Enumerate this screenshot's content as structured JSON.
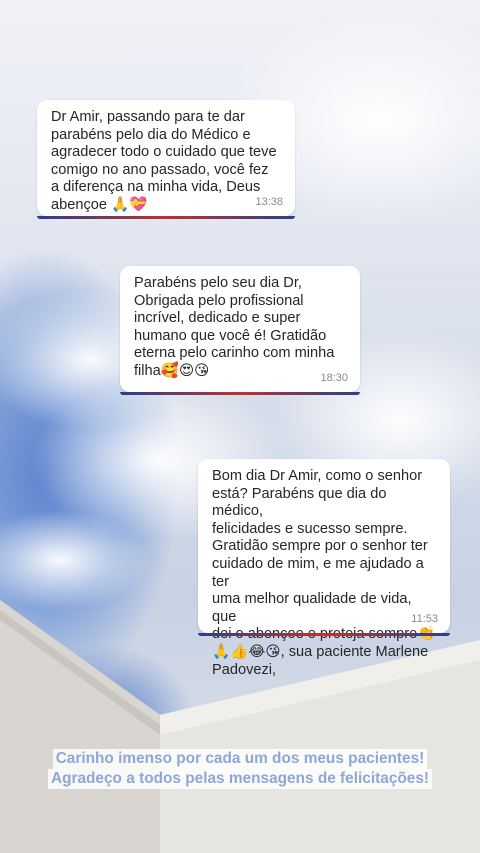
{
  "messages": [
    {
      "text": "Dr Amir, passando para te dar\nparabéns pelo dia do Médico e\nagradecer todo o cuidado que teve\ncomigo no ano passado, você fez\na diferença na minha vida, Deus\nabençoe 🙏💝",
      "time": "13:38"
    },
    {
      "text": "Parabéns pelo seu dia Dr,\nObrigada pelo profissional\nincrível,  dedicado e super\nhumano que você é!  Gratidão\neterna pelo carinho com minha\nfilha🥰😍😘",
      "time": "18:30"
    },
    {
      "text": "Bom dia Dr Amir, como o senhor\nestá? Parabéns que dia do médico,\nfelicidades e sucesso sempre.\nGratidão sempre  por o senhor ter\ncuidado de mim, e me ajudado a ter\numa melhor qualidade de vida, que\ndei o abençoe e proteja sempre👏\n🙏👍😂😘, sua paciente Marlene\nPadovezi,",
      "time": "11:53"
    }
  ],
  "caption": {
    "line1": "Carinho imenso por cada um dos meus pacientes!",
    "line2": "Agradeço a todos pelas mensagens de felicitações!"
  },
  "colors": {
    "sky_top": "#eef1f8",
    "sky_blue": "#7ea0d8",
    "caption_text": "#8ea7d6",
    "building": "#e9e6e2"
  }
}
